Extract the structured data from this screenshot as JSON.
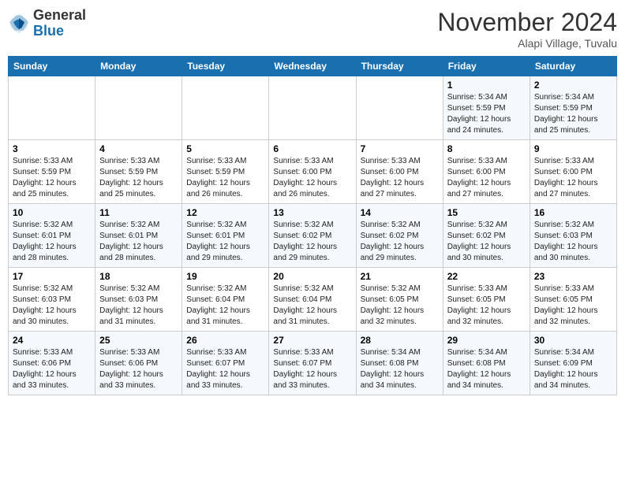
{
  "header": {
    "logo_general": "General",
    "logo_blue": "Blue",
    "month_title": "November 2024",
    "location": "Alapi Village, Tuvalu"
  },
  "weekdays": [
    "Sunday",
    "Monday",
    "Tuesday",
    "Wednesday",
    "Thursday",
    "Friday",
    "Saturday"
  ],
  "weeks": [
    [
      {
        "day": "",
        "info": ""
      },
      {
        "day": "",
        "info": ""
      },
      {
        "day": "",
        "info": ""
      },
      {
        "day": "",
        "info": ""
      },
      {
        "day": "",
        "info": ""
      },
      {
        "day": "1",
        "info": "Sunrise: 5:34 AM\nSunset: 5:59 PM\nDaylight: 12 hours and 24 minutes."
      },
      {
        "day": "2",
        "info": "Sunrise: 5:34 AM\nSunset: 5:59 PM\nDaylight: 12 hours and 25 minutes."
      }
    ],
    [
      {
        "day": "3",
        "info": "Sunrise: 5:33 AM\nSunset: 5:59 PM\nDaylight: 12 hours and 25 minutes."
      },
      {
        "day": "4",
        "info": "Sunrise: 5:33 AM\nSunset: 5:59 PM\nDaylight: 12 hours and 25 minutes."
      },
      {
        "day": "5",
        "info": "Sunrise: 5:33 AM\nSunset: 5:59 PM\nDaylight: 12 hours and 26 minutes."
      },
      {
        "day": "6",
        "info": "Sunrise: 5:33 AM\nSunset: 6:00 PM\nDaylight: 12 hours and 26 minutes."
      },
      {
        "day": "7",
        "info": "Sunrise: 5:33 AM\nSunset: 6:00 PM\nDaylight: 12 hours and 27 minutes."
      },
      {
        "day": "8",
        "info": "Sunrise: 5:33 AM\nSunset: 6:00 PM\nDaylight: 12 hours and 27 minutes."
      },
      {
        "day": "9",
        "info": "Sunrise: 5:33 AM\nSunset: 6:00 PM\nDaylight: 12 hours and 27 minutes."
      }
    ],
    [
      {
        "day": "10",
        "info": "Sunrise: 5:32 AM\nSunset: 6:01 PM\nDaylight: 12 hours and 28 minutes."
      },
      {
        "day": "11",
        "info": "Sunrise: 5:32 AM\nSunset: 6:01 PM\nDaylight: 12 hours and 28 minutes."
      },
      {
        "day": "12",
        "info": "Sunrise: 5:32 AM\nSunset: 6:01 PM\nDaylight: 12 hours and 29 minutes."
      },
      {
        "day": "13",
        "info": "Sunrise: 5:32 AM\nSunset: 6:02 PM\nDaylight: 12 hours and 29 minutes."
      },
      {
        "day": "14",
        "info": "Sunrise: 5:32 AM\nSunset: 6:02 PM\nDaylight: 12 hours and 29 minutes."
      },
      {
        "day": "15",
        "info": "Sunrise: 5:32 AM\nSunset: 6:02 PM\nDaylight: 12 hours and 30 minutes."
      },
      {
        "day": "16",
        "info": "Sunrise: 5:32 AM\nSunset: 6:03 PM\nDaylight: 12 hours and 30 minutes."
      }
    ],
    [
      {
        "day": "17",
        "info": "Sunrise: 5:32 AM\nSunset: 6:03 PM\nDaylight: 12 hours and 30 minutes."
      },
      {
        "day": "18",
        "info": "Sunrise: 5:32 AM\nSunset: 6:03 PM\nDaylight: 12 hours and 31 minutes."
      },
      {
        "day": "19",
        "info": "Sunrise: 5:32 AM\nSunset: 6:04 PM\nDaylight: 12 hours and 31 minutes."
      },
      {
        "day": "20",
        "info": "Sunrise: 5:32 AM\nSunset: 6:04 PM\nDaylight: 12 hours and 31 minutes."
      },
      {
        "day": "21",
        "info": "Sunrise: 5:32 AM\nSunset: 6:05 PM\nDaylight: 12 hours and 32 minutes."
      },
      {
        "day": "22",
        "info": "Sunrise: 5:33 AM\nSunset: 6:05 PM\nDaylight: 12 hours and 32 minutes."
      },
      {
        "day": "23",
        "info": "Sunrise: 5:33 AM\nSunset: 6:05 PM\nDaylight: 12 hours and 32 minutes."
      }
    ],
    [
      {
        "day": "24",
        "info": "Sunrise: 5:33 AM\nSunset: 6:06 PM\nDaylight: 12 hours and 33 minutes."
      },
      {
        "day": "25",
        "info": "Sunrise: 5:33 AM\nSunset: 6:06 PM\nDaylight: 12 hours and 33 minutes."
      },
      {
        "day": "26",
        "info": "Sunrise: 5:33 AM\nSunset: 6:07 PM\nDaylight: 12 hours and 33 minutes."
      },
      {
        "day": "27",
        "info": "Sunrise: 5:33 AM\nSunset: 6:07 PM\nDaylight: 12 hours and 33 minutes."
      },
      {
        "day": "28",
        "info": "Sunrise: 5:34 AM\nSunset: 6:08 PM\nDaylight: 12 hours and 34 minutes."
      },
      {
        "day": "29",
        "info": "Sunrise: 5:34 AM\nSunset: 6:08 PM\nDaylight: 12 hours and 34 minutes."
      },
      {
        "day": "30",
        "info": "Sunrise: 5:34 AM\nSunset: 6:09 PM\nDaylight: 12 hours and 34 minutes."
      }
    ]
  ]
}
